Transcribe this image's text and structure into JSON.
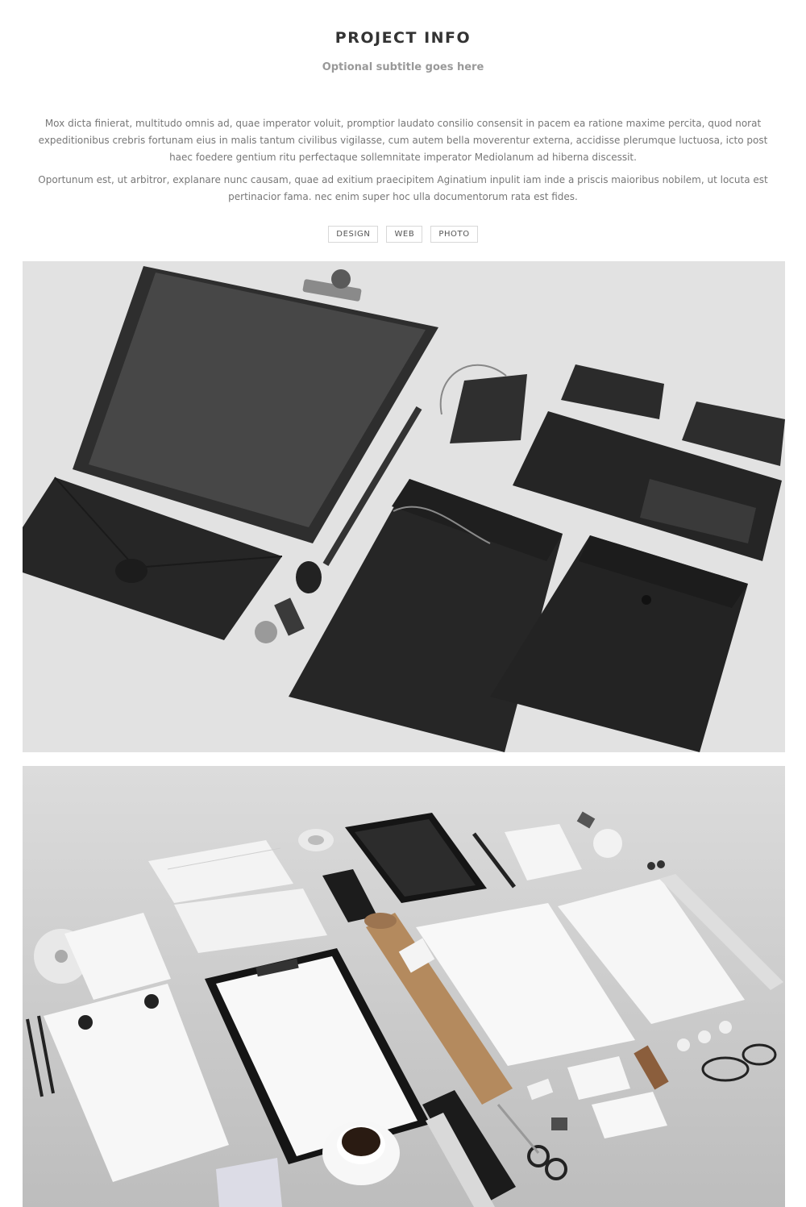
{
  "project": {
    "title": "PROJECT INFO",
    "subtitle": "Optional subtitle goes here",
    "paragraphs": [
      "Mox dicta finierat, multitudo omnis ad, quae imperator voluit, promptior laudato consilio consensit in pacem ea ratione maxime percita, quod norat expeditionibus crebris fortunam eius in malis tantum civilibus vigilasse, cum autem bella moverentur externa, accidisse plerumque luctuosa, icto post haec foedere gentium ritu perfectaque sollemnitate imperator Mediolanum ad hiberna discessit.",
      "Oportunum est, ut arbitror, explanare nunc causam, quae ad exitium praecipitem Aginatium inpulit iam inde a priscis maioribus nobilem, ut locuta est pertinacior fama. nec enim super hoc ulla documentorum rata est fides."
    ],
    "tags": [
      "DESIGN",
      "WEB",
      "PHOTO"
    ]
  },
  "images": [
    {
      "name": "black stationery mockup"
    },
    {
      "name": "white stationery mockup"
    }
  ]
}
